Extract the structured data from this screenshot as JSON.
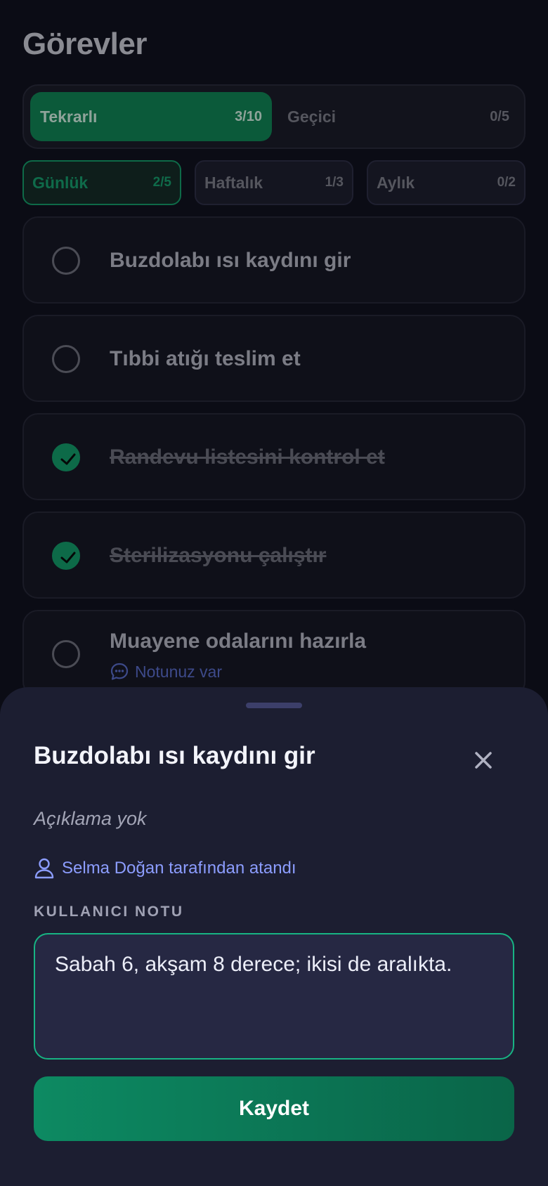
{
  "page": {
    "title": "Görevler"
  },
  "segments": [
    {
      "label": "Tekrarlı",
      "count": "3/10"
    },
    {
      "label": "Geçici",
      "count": "0/5"
    }
  ],
  "filters": [
    {
      "label": "Günlük",
      "count": "2/5"
    },
    {
      "label": "Haftalık",
      "count": "1/3"
    },
    {
      "label": "Aylık",
      "count": "0/2"
    }
  ],
  "tasks": [
    {
      "title": "Buzdolabı ısı kaydını gir",
      "done": false
    },
    {
      "title": "Tıbbi atığı teslim et",
      "done": false
    },
    {
      "title": "Randevu listesini kontrol et",
      "done": true
    },
    {
      "title": "Sterilizasyonu çalıştır",
      "done": true
    },
    {
      "title": "Muayene odalarını hazırla",
      "done": false,
      "note": "Notunuz var"
    }
  ],
  "sheet": {
    "title": "Buzdolabı ısı kaydını gir",
    "description": "Açıklama yok",
    "assigned_by": "Selma Doğan tarafından atandı",
    "note_label": "KULLANICI NOTU",
    "note_value": "Sabah 6, akşam 8 derece; ikisi de aralıkta.",
    "save_label": "Kaydet"
  },
  "colors": {
    "accent": "#17b483",
    "button": "#0d8a62",
    "link": "#8c9dff"
  }
}
